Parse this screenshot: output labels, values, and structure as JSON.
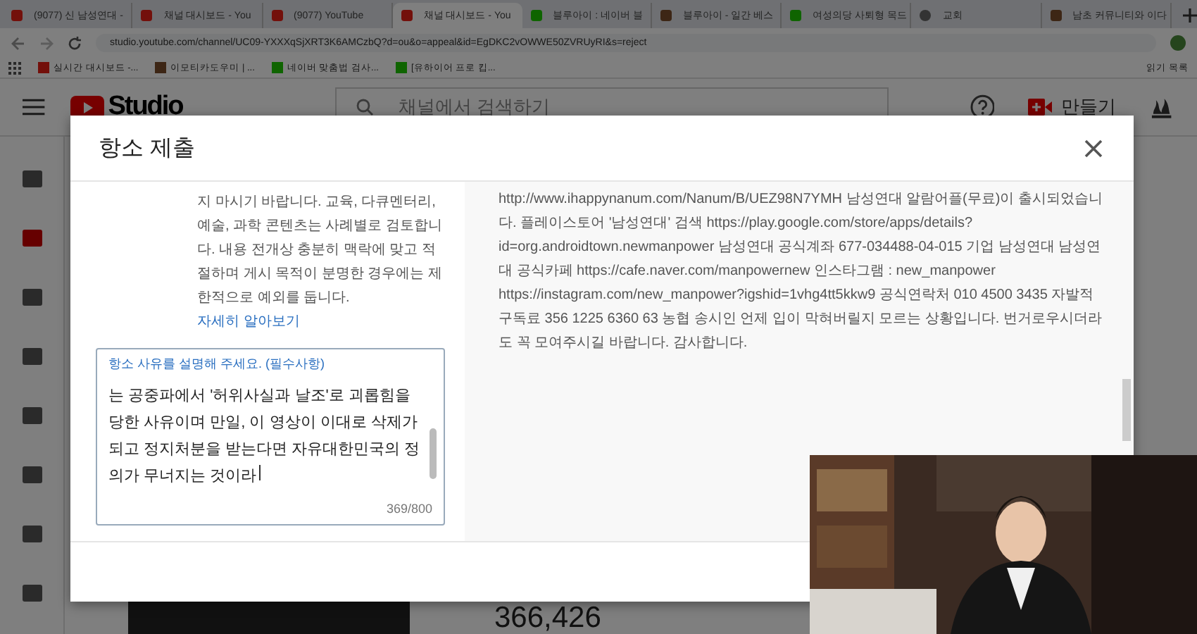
{
  "browser": {
    "tabs": [
      {
        "title": "(9077) 신 남성연대 -",
        "selected": false,
        "kind": "video"
      },
      {
        "title": "채널 대시보드 - You",
        "selected": false,
        "kind": "video"
      },
      {
        "title": "(9077) YouTube",
        "selected": false,
        "kind": "video"
      },
      {
        "title": "채널 대시보드 - You",
        "selected": true,
        "kind": "video"
      },
      {
        "title": "블루아이 : 네이버 블",
        "selected": false,
        "kind": "naver"
      },
      {
        "title": "블루아이 - 일간 베스",
        "selected": false,
        "kind": "page"
      },
      {
        "title": "여성의당 사퇴형 목드",
        "selected": false,
        "kind": "naver"
      },
      {
        "title": "교회",
        "selected": false,
        "kind": "globe"
      },
      {
        "title": "남초 커뮤니티와 이다",
        "selected": false,
        "kind": "page"
      }
    ],
    "url": "studio.youtube.com/channel/UC09-YXXXqSjXRT3K6AMCzbQ?d=ou&o=appeal&id=EgDKC2vOWWE50ZVRUyRI&s=reject",
    "bookmarks": [
      {
        "title": "실시간 대시보드 -...",
        "kind": "video"
      },
      {
        "title": "이모티카도우미 | ...",
        "kind": "page"
      },
      {
        "title": "네이버 맞춤법 검사...",
        "kind": "naver"
      },
      {
        "title": "[유하이어 프로 킵...",
        "kind": "naver"
      }
    ],
    "reading_list": "읽기 목록"
  },
  "studio": {
    "logo": "Studio",
    "search_placeholder": "채널에서 검색하기",
    "create_button": "만들기",
    "stat": "366,426"
  },
  "dialog": {
    "title": "항소 제출",
    "guideline": "지 마시기 바랍니다. 교육, 다큐멘터리, 예술, 과학 콘텐츠는 사례별로 검토합니다. 내용 전개상 충분히 맥락에 맞고 적절하며 게시 목적이 분명한 경우에는 제한적으로 예외를 둡니다.",
    "learn_more": "자세히 알아보기",
    "field": {
      "label": "항소 사유를 설명해 주세요. (필수사항)",
      "value": "는 공중파에서 '허위사실과 날조'로 괴롭힘을 당한 사유이며 만일, 이 영상이 이대로 삭제가 되고 정지처분을 받는다면 자유대한민국의 정의가 무너지는 것이라",
      "counter": "369/800"
    },
    "description": "http://www.ihappynanum.com/Nanum/B/UEZ98N7YMH 남성연대 알람어플(무료)이 출시되었습니다. 플레이스토어 '남성연대' 검색 https://play.google.com/store/apps/details?id=org.androidtown.newmanpower 남성연대 공식계좌 677-034488-04-015 기업 남성연대 남성연대 공식카페 https://cafe.naver.com/manpowernew 인스타그램 : new_manpower https://instagram.com/new_manpower?igshid=1vhg4tt5kkw9 공식연락처 010 4500 3435 자발적 구독료 356 1225 6360 63 농협 송시인 언제 입이 막혀버릴지 모르는 상황입니다. 번거로우시더라도 꼭 모여주시길 바랍니다. 감사합니다."
  }
}
